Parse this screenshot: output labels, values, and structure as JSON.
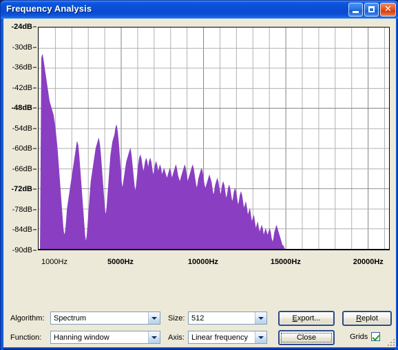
{
  "window": {
    "title": "Frequency Analysis",
    "caption_buttons": [
      {
        "name": "minimize",
        "label": "Minimize"
      },
      {
        "name": "maximize",
        "label": "Maximize"
      },
      {
        "name": "close",
        "label": "Close"
      }
    ]
  },
  "colors": {
    "spectrum": "#8a3ec2",
    "plot_background": "#ffffff",
    "grid_minor": "#b0b0b0",
    "grid_major": "#808080",
    "window_face": "#ece9d8",
    "titlebar": "#0a4fd4",
    "check_green": "#1a9a1a"
  },
  "controls": {
    "algorithm_label": "Algorithm:",
    "algorithm_value": "Spectrum",
    "function_label": "Function:",
    "function_value": "Hanning window",
    "size_label": "Size:",
    "size_value": "512",
    "axis_label": "Axis:",
    "axis_value": "Linear frequency",
    "export_button": "Export...",
    "export_accel": "E",
    "export_rest": "xport...",
    "replot_button": "Replot",
    "replot_accel": "R",
    "replot_rest": "eplot",
    "close_button": "Close",
    "grids_label": "Grids",
    "grids_checked": "true"
  },
  "chart_data": {
    "type": "area",
    "title": "Frequency Analysis",
    "xlabel": "",
    "ylabel": "",
    "grid": true,
    "legend_position": "none",
    "xlim": [
      0,
      21300
    ],
    "ylim": [
      -90,
      -24
    ],
    "x_unit": "Hz",
    "y_unit": "dB",
    "x_tick_interval": 1000,
    "y_tick_interval": 6,
    "x_ticks": [
      {
        "value": 1000,
        "label": "1000Hz",
        "major": false
      },
      {
        "value": 5000,
        "label": "5000Hz",
        "major": true
      },
      {
        "value": 10000,
        "label": "10000Hz",
        "major": true
      },
      {
        "value": 15000,
        "label": "15000Hz",
        "major": true
      },
      {
        "value": 20000,
        "label": "20000Hz",
        "major": true
      }
    ],
    "y_ticks": [
      {
        "value": -24,
        "label": "-24dB",
        "major": true
      },
      {
        "value": -30,
        "label": "-30dB",
        "major": false
      },
      {
        "value": -36,
        "label": "-36dB",
        "major": false
      },
      {
        "value": -42,
        "label": "-42dB",
        "major": false
      },
      {
        "value": -48,
        "label": "-48dB",
        "major": true
      },
      {
        "value": -54,
        "label": "-54dB",
        "major": false
      },
      {
        "value": -60,
        "label": "-60dB",
        "major": false
      },
      {
        "value": -66,
        "label": "-66dB",
        "major": false
      },
      {
        "value": -72,
        "label": "-72dB",
        "major": true
      },
      {
        "value": -78,
        "label": "-78dB",
        "major": false
      },
      {
        "value": -84,
        "label": "-84dB",
        "major": false
      },
      {
        "value": -90,
        "label": "-90dB",
        "major": false
      }
    ],
    "series_name": "Spectrum",
    "series_color": "#8a3ec2",
    "x": [
      100,
      180,
      240,
      300,
      360,
      420,
      480,
      540,
      600,
      660,
      720,
      780,
      840,
      900,
      960,
      1020,
      1080,
      1140,
      1200,
      1260,
      1320,
      1380,
      1440,
      1500,
      1560,
      1620,
      1680,
      1740,
      1800,
      1860,
      1920,
      1980,
      2040,
      2100,
      2160,
      2220,
      2280,
      2340,
      2400,
      2460,
      2520,
      2580,
      2640,
      2700,
      2760,
      2820,
      2880,
      2940,
      3000,
      3060,
      3120,
      3180,
      3240,
      3300,
      3360,
      3420,
      3480,
      3540,
      3600,
      3660,
      3720,
      3780,
      3840,
      3900,
      3960,
      4020,
      4080,
      4140,
      4200,
      4260,
      4320,
      4380,
      4440,
      4500,
      4560,
      4620,
      4680,
      4740,
      4800,
      4860,
      4920,
      4980,
      5040,
      5100,
      5160,
      5220,
      5280,
      5340,
      5400,
      5460,
      5520,
      5580,
      5640,
      5700,
      5760,
      5820,
      5880,
      5940,
      6000,
      6060,
      6120,
      6180,
      6240,
      6300,
      6360,
      6420,
      6480,
      6540,
      6600,
      6660,
      6720,
      6780,
      6840,
      6900,
      6960,
      7020,
      7080,
      7140,
      7200,
      7260,
      7320,
      7380,
      7440,
      7500,
      7560,
      7620,
      7680,
      7740,
      7800,
      7860,
      7920,
      7980,
      8040,
      8100,
      8160,
      8220,
      8280,
      8340,
      8400,
      8460,
      8520,
      8580,
      8640,
      8700,
      8760,
      8820,
      8880,
      8940,
      9000,
      9060,
      9120,
      9180,
      9240,
      9300,
      9360,
      9420,
      9480,
      9540,
      9600,
      9660,
      9720,
      9780,
      9840,
      9900,
      9960,
      10020,
      10080,
      10140,
      10200,
      10260,
      10320,
      10380,
      10440,
      10500,
      10560,
      10620,
      10680,
      10740,
      10800,
      10860,
      10920,
      10980,
      11040,
      11100,
      11160,
      11220,
      11280,
      11340,
      11400,
      11460,
      11520,
      11580,
      11640,
      11700,
      11760,
      11820,
      11880,
      11940,
      12000,
      12060,
      12120,
      12180,
      12240,
      12300,
      12360,
      12420,
      12480,
      12540,
      12600,
      12660,
      12720,
      12780,
      12840,
      12900,
      12960,
      13020,
      13080,
      13140,
      13200,
      13260,
      13320,
      13380,
      13440,
      13500,
      13560,
      13620,
      13680,
      13740,
      13800,
      13860,
      13920,
      13980,
      14040,
      14100,
      14160,
      14220,
      14280,
      14340,
      14400,
      14460,
      14520,
      14580,
      14640,
      14700,
      14760,
      14820,
      14880,
      14940,
      15000,
      15020
    ],
    "y": [
      -90,
      -33,
      -32,
      -34,
      -36,
      -38,
      -40,
      -42,
      -44,
      -46,
      -47,
      -48,
      -49,
      -50,
      -52,
      -54,
      -57,
      -60,
      -64,
      -68,
      -72,
      -76,
      -80,
      -84,
      -86,
      -85,
      -82,
      -78,
      -76,
      -74,
      -72,
      -70,
      -68,
      -66,
      -64,
      -62,
      -60,
      -58,
      -59,
      -62,
      -66,
      -70,
      -74,
      -78,
      -82,
      -86,
      -88,
      -86,
      -82,
      -78,
      -74,
      -70,
      -68,
      -66,
      -64,
      -62,
      -60,
      -59,
      -58,
      -57,
      -59,
      -62,
      -66,
      -70,
      -74,
      -78,
      -80,
      -78,
      -74,
      -70,
      -66,
      -62,
      -60,
      -58,
      -57,
      -56,
      -54,
      -53,
      -55,
      -58,
      -62,
      -66,
      -70,
      -72,
      -70,
      -68,
      -66,
      -64,
      -63,
      -62,
      -61,
      -60,
      -62,
      -65,
      -68,
      -71,
      -73,
      -71,
      -68,
      -65,
      -63,
      -62,
      -63,
      -65,
      -67,
      -66,
      -64,
      -63,
      -64,
      -66,
      -64,
      -63,
      -64,
      -66,
      -68,
      -67,
      -65,
      -64,
      -65,
      -67,
      -66,
      -65,
      -66,
      -68,
      -67,
      -66,
      -67,
      -68,
      -69,
      -68,
      -67,
      -66,
      -67,
      -69,
      -68,
      -67,
      -66,
      -65,
      -66,
      -68,
      -69,
      -70,
      -69,
      -68,
      -67,
      -66,
      -65,
      -66,
      -68,
      -70,
      -69,
      -68,
      -67,
      -66,
      -65,
      -66,
      -68,
      -70,
      -72,
      -71,
      -69,
      -68,
      -67,
      -66,
      -67,
      -69,
      -71,
      -72,
      -71,
      -70,
      -69,
      -68,
      -69,
      -70,
      -72,
      -74,
      -73,
      -71,
      -70,
      -69,
      -70,
      -72,
      -74,
      -73,
      -71,
      -70,
      -71,
      -73,
      -75,
      -74,
      -72,
      -71,
      -72,
      -74,
      -76,
      -75,
      -73,
      -72,
      -73,
      -75,
      -77,
      -76,
      -74,
      -73,
      -74,
      -76,
      -78,
      -77,
      -76,
      -78,
      -80,
      -79,
      -78,
      -80,
      -82,
      -81,
      -80,
      -82,
      -84,
      -83,
      -82,
      -84,
      -85,
      -84,
      -83,
      -84,
      -86,
      -85,
      -84,
      -85,
      -86,
      -85,
      -84,
      -85,
      -87,
      -88,
      -87,
      -85,
      -84,
      -83,
      -84,
      -85,
      -86,
      -87,
      -88,
      -89,
      -89,
      -90,
      -90,
      -90
    ]
  }
}
